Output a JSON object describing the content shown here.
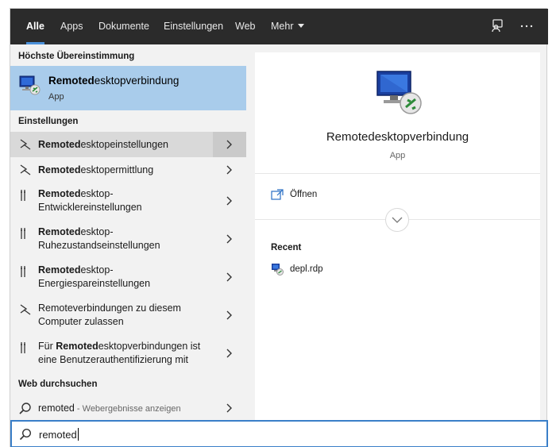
{
  "nav": {
    "tabs": [
      {
        "label": "Alle",
        "active": true
      },
      {
        "label": "Apps"
      },
      {
        "label": "Dokumente"
      },
      {
        "label": "Einstellungen"
      },
      {
        "label": "Web"
      },
      {
        "label": "Mehr"
      }
    ],
    "more_icon": "ellipsis-icon",
    "feedback_icon": "feedback-icon"
  },
  "best_match": {
    "header": "Höchste Übereinstimmung",
    "title_bold": "Remoted",
    "title_rest": "esktopverbindung",
    "subtitle": "App"
  },
  "settings": {
    "header": "Einstellungen",
    "items": [
      {
        "pre": "",
        "bold": "Remoted",
        "rest": "esktopeinstellungen",
        "icon": "remote-settings-icon"
      },
      {
        "pre": "",
        "bold": "Remoted",
        "rest": "esktopermittlung",
        "icon": "remote-settings-icon"
      },
      {
        "pre": "",
        "bold": "Remoted",
        "rest": "esktop-Entwicklereinstellungen",
        "icon": "tools-icon"
      },
      {
        "pre": "",
        "bold": "Remoted",
        "rest": "esktop-Ruhezustandseinstellungen",
        "icon": "tools-icon"
      },
      {
        "pre": "",
        "bold": "Remoted",
        "rest": "esktop-Energiespareinstellungen",
        "icon": "tools-icon"
      },
      {
        "pre": "Remoteverbindungen zu diesem Computer zulassen",
        "bold": "",
        "rest": "",
        "icon": "remote-settings-icon"
      },
      {
        "pre": "Für ",
        "bold": "Remoted",
        "rest": "esktopverbindungen ist eine Benutzerauthentifizierung mit",
        "icon": "tools-icon"
      }
    ]
  },
  "web": {
    "header": "Web durchsuchen",
    "query": "remoted",
    "suffix": " - Webergebnisse anzeigen"
  },
  "detail": {
    "title": "Remotedesktopverbindung",
    "subtitle": "App",
    "open_label": "Öffnen",
    "recent_header": "Recent",
    "recent_items": [
      "depl.rdp"
    ]
  },
  "search": {
    "value": "remoted"
  },
  "colors": {
    "accent": "#3a7fc8",
    "highlight": "#a9cceb",
    "nav_bg": "#2b2b2b"
  }
}
